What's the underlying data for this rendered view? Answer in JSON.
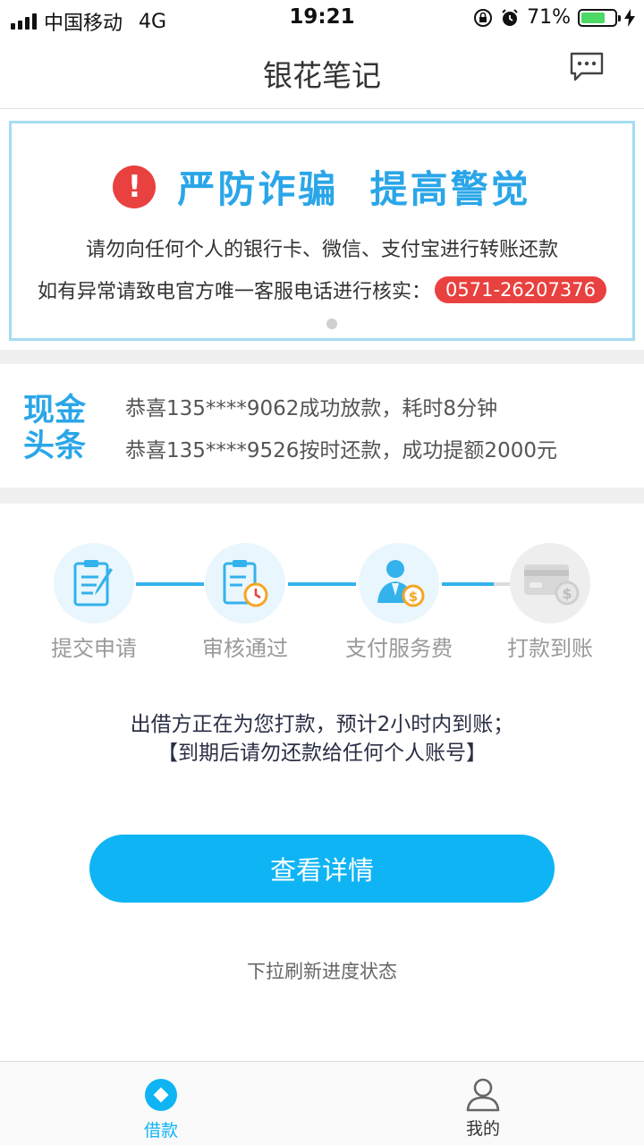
{
  "status_bar": {
    "carrier": "中国移动",
    "network": "4G",
    "time": "19:21",
    "battery": "71%",
    "battery_level": 0.71
  },
  "header": {
    "title": "银花笔记",
    "message_icon": "chat-bubble-icon"
  },
  "banner": {
    "alert_icon": "exclamation-circle-icon",
    "title": "严防诈骗  提高警觉",
    "line1": "请勿向任何个人的银行卡、微信、支付宝进行转账还款",
    "line2_prefix": "如有异常请致电官方唯一客服电话进行核实：",
    "phone": "0571-26207376"
  },
  "news": {
    "logo_line1": "现金",
    "logo_line2": "头条",
    "items": [
      "恭喜135****9062成功放款，耗时8分钟",
      "恭喜135****9526按时还款，成功提额2000元"
    ]
  },
  "steps": [
    {
      "label": "提交申请",
      "icon": "clipboard-pen-icon",
      "done": true
    },
    {
      "label": "审核通过",
      "icon": "clipboard-clock-icon",
      "done": true
    },
    {
      "label": "支付服务费",
      "icon": "person-coin-icon",
      "done": true
    },
    {
      "label": "打款到账",
      "icon": "card-coin-icon",
      "done": false
    }
  ],
  "status_message": {
    "line1": "出借方正在为您打款，预计2小时内到账；",
    "line2": "【到期后请勿还款给任何个人账号】"
  },
  "detail_button": "查看详情",
  "refresh_hint": "下拉刷新进度状态",
  "tabs": [
    {
      "label": "借款",
      "icon": "diamond-circle-icon",
      "active": true
    },
    {
      "label": "我的",
      "icon": "user-icon",
      "active": false
    }
  ],
  "colors": {
    "accent": "#0fb4f4",
    "warning": "#e8413f",
    "banner_border": "#a5dcf4"
  }
}
